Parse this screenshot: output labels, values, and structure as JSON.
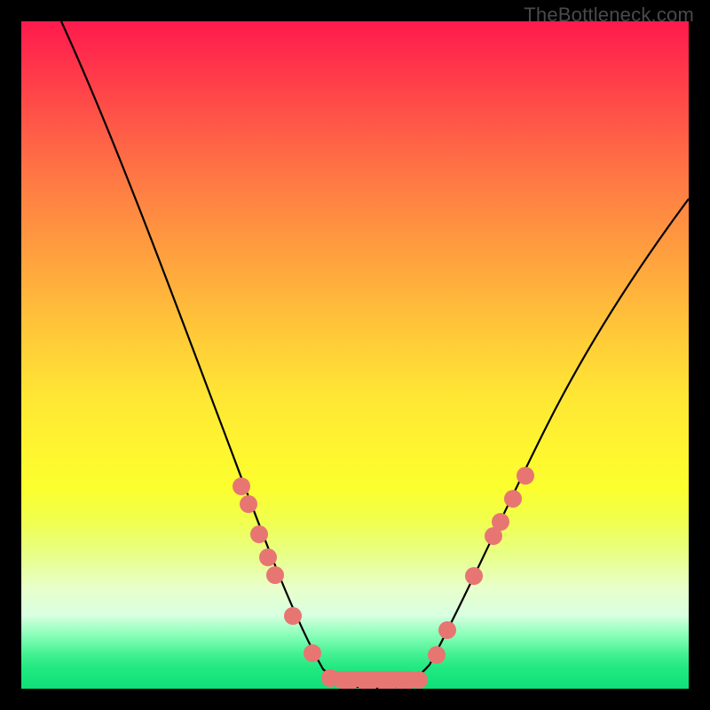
{
  "watermark": "TheBottleneck.com",
  "chart_data": {
    "type": "line",
    "title": "",
    "xlabel": "",
    "ylabel": "",
    "xlim": [
      0,
      100
    ],
    "ylim": [
      0,
      100
    ],
    "grid": false,
    "series": [
      {
        "name": "bottleneck-curve",
        "x": [
          6,
          10,
          15,
          20,
          25,
          30,
          33,
          36,
          39,
          42,
          45,
          48,
          51,
          54,
          57,
          60,
          64,
          68,
          72,
          76,
          80,
          85,
          90,
          95,
          100
        ],
        "y": [
          100,
          89,
          77,
          64,
          51,
          38,
          30,
          22,
          14,
          7,
          2,
          0,
          0,
          0,
          0,
          2,
          8,
          15,
          22,
          29,
          35,
          42,
          48,
          54,
          59
        ]
      }
    ],
    "markers": [
      {
        "x": 33,
        "y": 30
      },
      {
        "x": 34,
        "y": 28
      },
      {
        "x": 36,
        "y": 22
      },
      {
        "x": 37,
        "y": 18
      },
      {
        "x": 38,
        "y": 16
      },
      {
        "x": 41,
        "y": 9
      },
      {
        "x": 44,
        "y": 3
      },
      {
        "x": 47,
        "y": 0
      },
      {
        "x": 49,
        "y": 0
      },
      {
        "x": 52,
        "y": 0
      },
      {
        "x": 55,
        "y": 0
      },
      {
        "x": 57,
        "y": 0
      },
      {
        "x": 59,
        "y": 1
      },
      {
        "x": 62,
        "y": 5
      },
      {
        "x": 64,
        "y": 10
      },
      {
        "x": 68,
        "y": 17
      },
      {
        "x": 71,
        "y": 22
      },
      {
        "x": 72,
        "y": 24
      },
      {
        "x": 74,
        "y": 27
      },
      {
        "x": 76,
        "y": 30
      }
    ],
    "background_gradient": {
      "type": "vertical",
      "stops": [
        {
          "pos": 0,
          "color": "#ff1a4d"
        },
        {
          "pos": 50,
          "color": "#ffd634"
        },
        {
          "pos": 85,
          "color": "#f0ffd0"
        },
        {
          "pos": 100,
          "color": "#18e078"
        }
      ]
    },
    "curve_color": "#000000",
    "marker_color": "#e77672"
  }
}
